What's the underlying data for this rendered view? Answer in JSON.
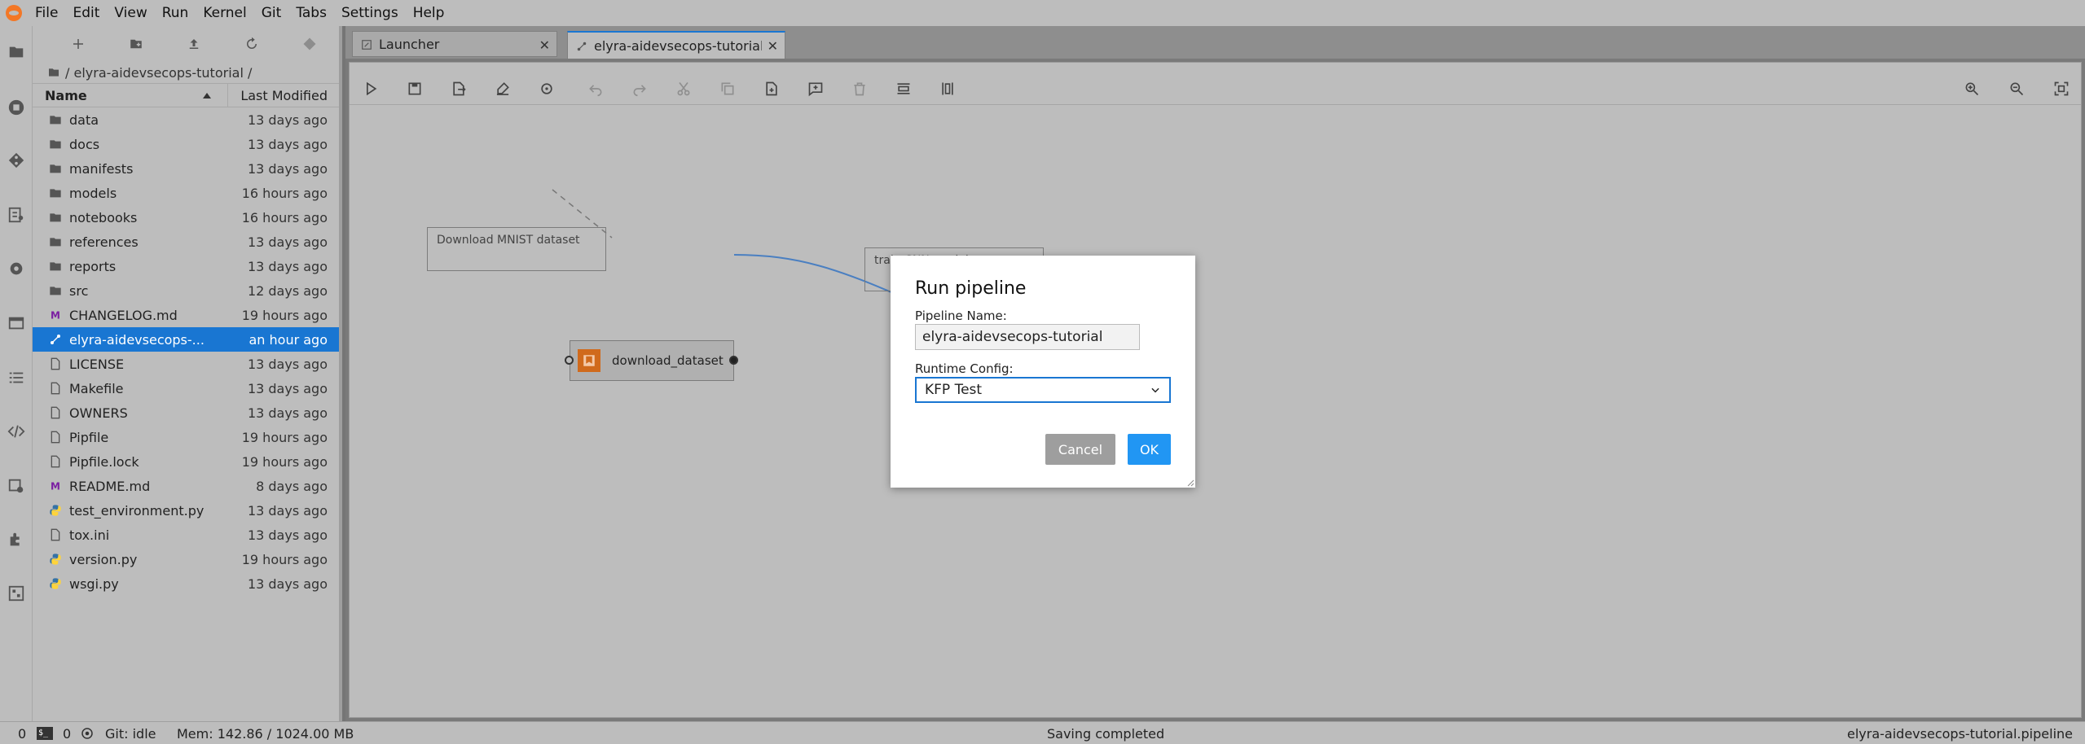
{
  "menu": [
    "File",
    "Edit",
    "View",
    "Run",
    "Kernel",
    "Git",
    "Tabs",
    "Settings",
    "Help"
  ],
  "activity_icons": [
    "folder-icon",
    "running-icon",
    "git-icon",
    "property-inspector-icon",
    "gear-icon",
    "tabs-icon",
    "toc-icon",
    "code-snippet-icon",
    "runtimes-icon",
    "extension-icon",
    "component-catalog-icon"
  ],
  "file_browser": {
    "breadcrumb": "/ elyra-aidevsecops-tutorial /",
    "col_name": "Name",
    "col_modified": "Last Modified",
    "files": [
      {
        "name": "data",
        "modified": "13 days ago",
        "type": "folder"
      },
      {
        "name": "docs",
        "modified": "13 days ago",
        "type": "folder"
      },
      {
        "name": "manifests",
        "modified": "13 days ago",
        "type": "folder"
      },
      {
        "name": "models",
        "modified": "16 hours ago",
        "type": "folder"
      },
      {
        "name": "notebooks",
        "modified": "16 hours ago",
        "type": "folder"
      },
      {
        "name": "references",
        "modified": "13 days ago",
        "type": "folder"
      },
      {
        "name": "reports",
        "modified": "13 days ago",
        "type": "folder"
      },
      {
        "name": "src",
        "modified": "12 days ago",
        "type": "folder"
      },
      {
        "name": "CHANGELOG.md",
        "modified": "19 hours ago",
        "type": "markdown"
      },
      {
        "name": "elyra-aidevsecops-...",
        "modified": "an hour ago",
        "type": "pipeline",
        "selected": true
      },
      {
        "name": "LICENSE",
        "modified": "13 days ago",
        "type": "file"
      },
      {
        "name": "Makefile",
        "modified": "13 days ago",
        "type": "file"
      },
      {
        "name": "OWNERS",
        "modified": "13 days ago",
        "type": "file"
      },
      {
        "name": "Pipfile",
        "modified": "19 hours ago",
        "type": "file"
      },
      {
        "name": "Pipfile.lock",
        "modified": "19 hours ago",
        "type": "file"
      },
      {
        "name": "README.md",
        "modified": "8 days ago",
        "type": "markdown"
      },
      {
        "name": "test_environment.py",
        "modified": "13 days ago",
        "type": "python"
      },
      {
        "name": "tox.ini",
        "modified": "13 days ago",
        "type": "file"
      },
      {
        "name": "version.py",
        "modified": "19 hours ago",
        "type": "python"
      },
      {
        "name": "wsgi.py",
        "modified": "13 days ago",
        "type": "python"
      }
    ]
  },
  "tabs": [
    {
      "label": "Launcher",
      "icon": "launcher-icon",
      "active": false
    },
    {
      "label": "elyra-aidevsecops-tutorial.p",
      "icon": "pipeline-icon",
      "active": true
    }
  ],
  "pipeline": {
    "comments": [
      "Download MNIST dataset",
      "train CNN model"
    ],
    "node_label": "download_dataset"
  },
  "dialog": {
    "title": "Run pipeline",
    "name_label": "Pipeline Name:",
    "name_value": "elyra-aidevsecops-tutorial",
    "runtime_label": "Runtime Config:",
    "runtime_value": "KFP Test",
    "cancel": "Cancel",
    "ok": "OK"
  },
  "status": {
    "kernels": "0",
    "terminals": "0",
    "git": "Git: idle",
    "mem": "Mem: 142.86 / 1024.00 MB",
    "message": "Saving completed",
    "file": "elyra-aidevsecops-tutorial.pipeline"
  },
  "colors": {
    "accent": "#1976d2",
    "ok_button": "#2196f3",
    "node_icon": "#d06a1c"
  }
}
